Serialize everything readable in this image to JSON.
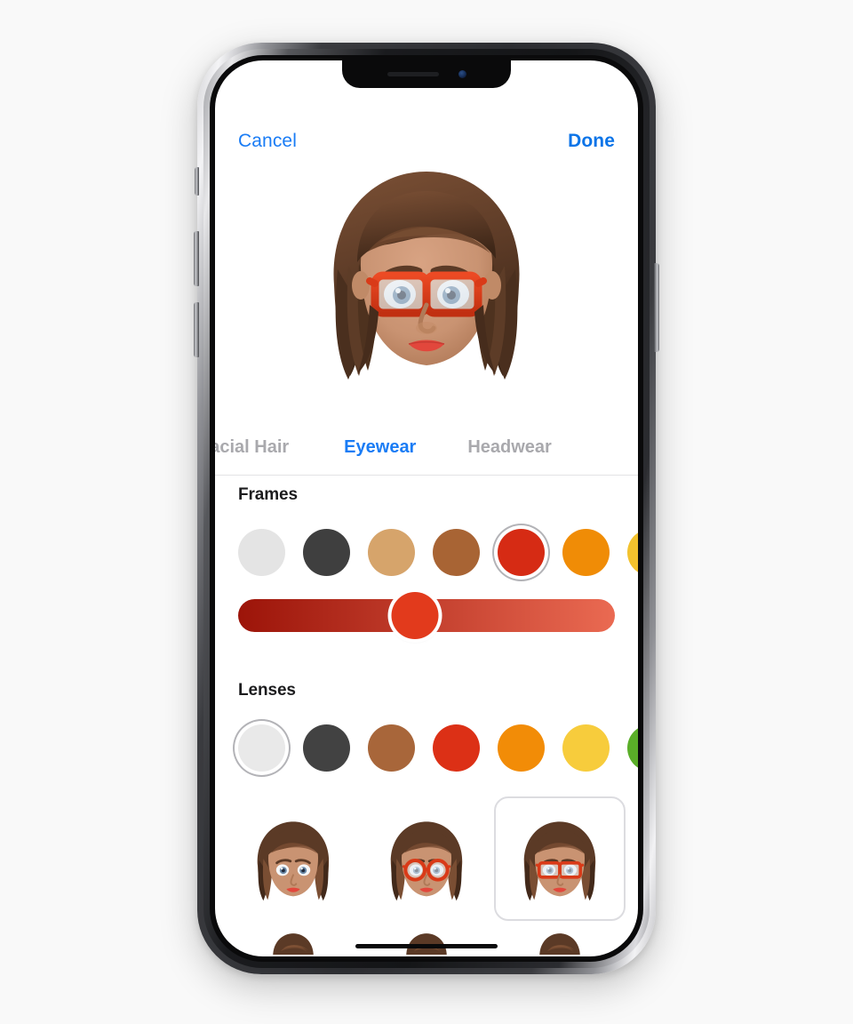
{
  "app": {
    "background_color": "#f9f9f9",
    "screen_background": "#ffffff"
  },
  "topbar": {
    "cancel_label": "Cancel",
    "done_label": "Done",
    "accent_color": "#1a7cf5"
  },
  "tabs": [
    {
      "label": "Facial Hair",
      "active": false
    },
    {
      "label": "Eyewear",
      "active": true
    },
    {
      "label": "Headwear",
      "active": false
    }
  ],
  "sections": {
    "frames": {
      "title": "Frames",
      "swatches": [
        {
          "name": "white",
          "color": "#e4e4e4",
          "selected": false
        },
        {
          "name": "charcoal",
          "color": "#3f3f3f",
          "selected": false
        },
        {
          "name": "tan",
          "color": "#d6a46b",
          "selected": false
        },
        {
          "name": "brown",
          "color": "#a86434",
          "selected": false
        },
        {
          "name": "red",
          "color": "#d62b14",
          "selected": true
        },
        {
          "name": "orange",
          "color": "#f08c06",
          "selected": false
        },
        {
          "name": "yellow",
          "color": "#f3c22e",
          "selected": false
        }
      ],
      "slider": {
        "gradient_from": "#9c1409",
        "gradient_to": "#ea6a52",
        "thumb_color": "#e23a1c",
        "value_percent": 47
      }
    },
    "lenses": {
      "title": "Lenses",
      "swatches": [
        {
          "name": "clear",
          "color": "#e9e9e9",
          "selected": true
        },
        {
          "name": "charcoal",
          "color": "#424242",
          "selected": false
        },
        {
          "name": "brown",
          "color": "#a8663a",
          "selected": false
        },
        {
          "name": "red",
          "color": "#dc3016",
          "selected": false
        },
        {
          "name": "orange",
          "color": "#f28c07",
          "selected": false
        },
        {
          "name": "yellow",
          "color": "#f7cc3c",
          "selected": false
        },
        {
          "name": "green",
          "color": "#5aae28",
          "selected": false
        }
      ]
    }
  },
  "eyewear_styles": [
    {
      "name": "none",
      "has_glasses": false,
      "shape": "none",
      "selected": false
    },
    {
      "name": "round-red",
      "has_glasses": true,
      "shape": "round",
      "selected": false
    },
    {
      "name": "square-red",
      "has_glasses": true,
      "shape": "rectangle",
      "selected": true
    }
  ],
  "memoji": {
    "skin_color": "#c99372",
    "skin_shadow": "#b07a58",
    "hair_color": "#5b3a26",
    "hair_highlight": "#7a4e33",
    "hair_dark": "#42291a",
    "eye_color": "#6b8aa8",
    "lip_color": "#e2473c",
    "frame_color": "#d93a18",
    "lens_color": "#dfe7ee"
  },
  "device": {
    "body_color": "#2c2d31",
    "notch": {
      "speaker": "speaker-grille",
      "camera": "front-camera"
    },
    "buttons": [
      "mute-switch",
      "volume-up",
      "volume-down",
      "side-button"
    ],
    "home_indicator": true
  }
}
